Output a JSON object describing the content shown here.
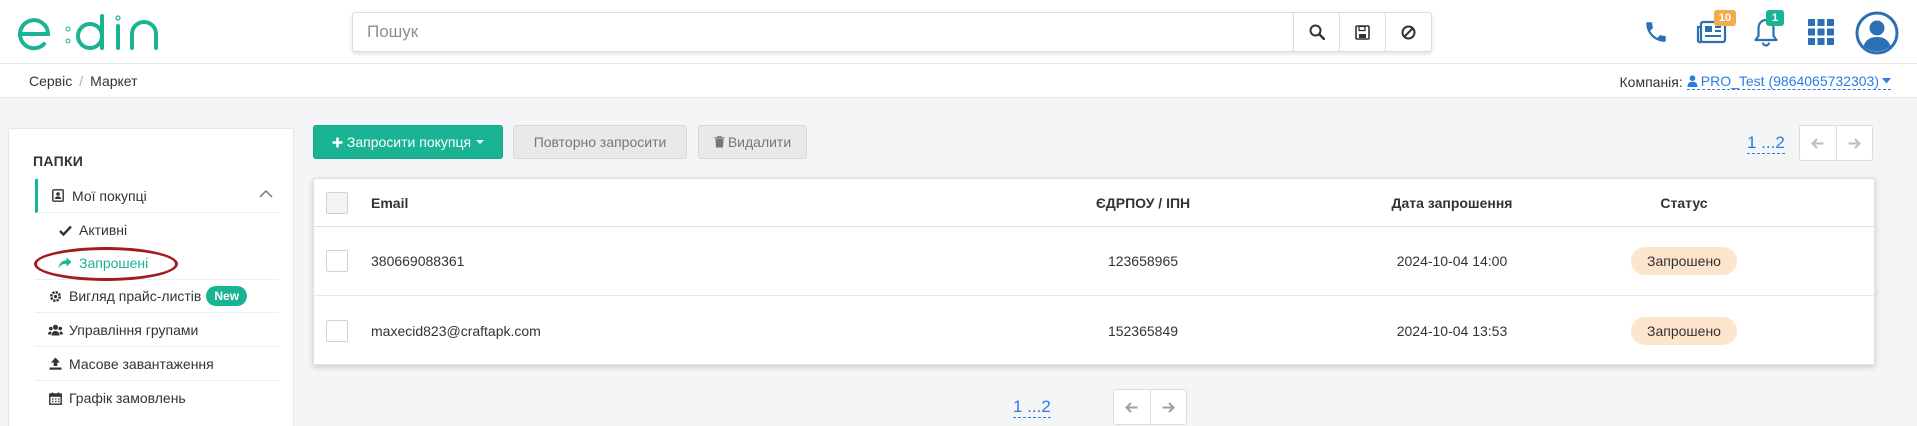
{
  "colors": {
    "accent": "#1ab394",
    "link": "#2c7be5",
    "highlight_ellipse": "#a31b1e",
    "status_bg": "#fde4cc"
  },
  "header": {
    "logo_text": "edin",
    "search": {
      "placeholder": "Пошук",
      "value": ""
    },
    "icons": [
      "phone-icon",
      "news-icon",
      "bell-icon",
      "apps-grid-icon",
      "user-avatar-icon"
    ],
    "news_count": "10",
    "notifications_count": "1"
  },
  "breadcrumb": {
    "items": [
      "Сервіс",
      "Маркет"
    ]
  },
  "company": {
    "label": "Компанія:",
    "name": "PRO_Test (9864065732303)"
  },
  "sidebar": {
    "title": "ПАПКИ",
    "items": [
      {
        "label": "Мої покупці",
        "icon": "contact-book-icon"
      },
      {
        "label": "Активні",
        "icon": "check-icon"
      },
      {
        "label": "Запрошені",
        "icon": "share-arrow-icon"
      },
      {
        "label": "Вигляд прайс-листів",
        "icon": "gear-icon",
        "badge": "New"
      },
      {
        "label": "Управління групами",
        "icon": "users-icon"
      },
      {
        "label": "Масове завантаження",
        "icon": "upload-icon"
      },
      {
        "label": "Графік замовлень",
        "icon": "calendar-icon"
      }
    ]
  },
  "toolbar": {
    "invite_label": "Запросити покупця",
    "reinvite_label": "Повторно запросити",
    "delete_label": "Видалити"
  },
  "pagination": {
    "pages_text": "1 ...2"
  },
  "table": {
    "columns": [
      "Email",
      "ЄДРПОУ / ІПН",
      "Дата запрошення",
      "Статус"
    ],
    "rows": [
      {
        "email": "380669088361",
        "code": "123658965",
        "date": "2024-10-04 14:00",
        "status": "Запрошено"
      },
      {
        "email": "maxecid823@craftapk.com",
        "code": "152365849",
        "date": "2024-10-04 13:53",
        "status": "Запрошено"
      }
    ]
  }
}
